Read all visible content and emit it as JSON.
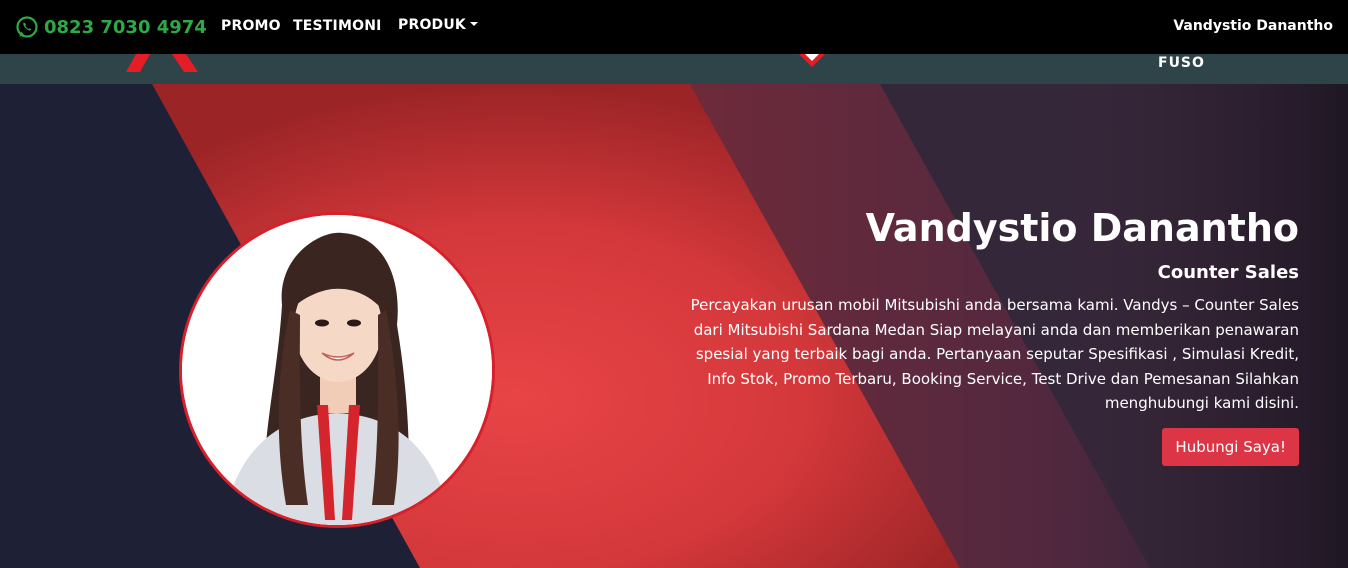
{
  "header": {
    "phone": "0823 7030 4974",
    "nav": [
      {
        "label": "PROMO"
      },
      {
        "label": "TESTIMONI"
      },
      {
        "label": "PRODUK"
      }
    ],
    "user_name": "Vandystio Danantho"
  },
  "brand_bar": {
    "fuso_label": "FUSO"
  },
  "hero": {
    "name": "Vandystio Danantho",
    "role": "Counter Sales",
    "description": "Percayakan urusan mobil Mitsubishi anda bersama kami. Vandys – Counter Sales dari Mitsubishi Sardana Medan Siap melayani anda dan memberikan penawaran spesial yang terbaik bagi anda. Pertanyaan seputar Spesifikasi , Simulasi Kredit, Info Stok, Promo Terbaru, Booking Service, Test Drive dan Pemesanan Silahkan menghubungi kami disini.",
    "cta_label": "Hubungi Saya!"
  },
  "colors": {
    "whatsapp_green": "#2fa846",
    "accent_red": "#dc3545",
    "topbar": "#000000",
    "subbar": "#2e4448"
  },
  "icons": {
    "phone": "whatsapp-icon",
    "dropdown": "caret-down-icon"
  }
}
